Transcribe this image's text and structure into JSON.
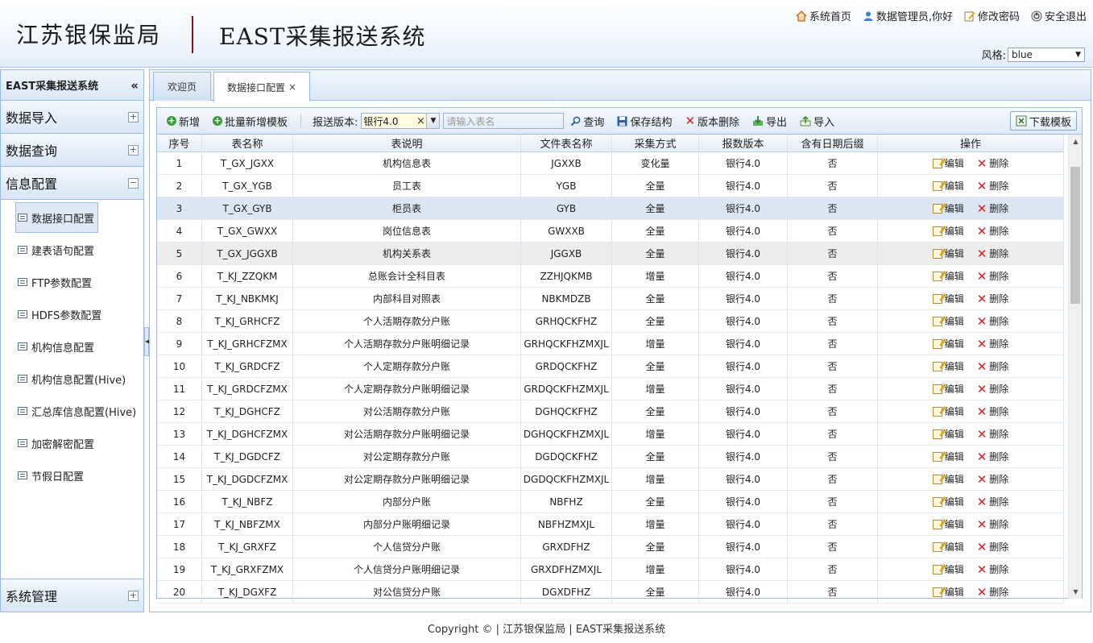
{
  "header": {
    "org_name": "江苏银保监局",
    "system_name": "EAST采集报送系统",
    "links": {
      "home": "系统首页",
      "user": "数据管理员,你好",
      "change_password": "修改密码",
      "logout": "安全退出"
    },
    "style_label": "风格:",
    "style_value": "blue"
  },
  "sidebar": {
    "title": "EAST采集报送系统",
    "collapse_glyph": "«",
    "groups": [
      {
        "label": "数据导入",
        "toggle": "+"
      },
      {
        "label": "数据查询",
        "toggle": "+"
      },
      {
        "label": "信息配置",
        "toggle": "−"
      }
    ],
    "items": [
      {
        "label": "数据接口配置"
      },
      {
        "label": "建表语句配置"
      },
      {
        "label": "FTP参数配置"
      },
      {
        "label": "HDFS参数配置"
      },
      {
        "label": "机构信息配置"
      },
      {
        "label": "机构信息配置(Hive)"
      },
      {
        "label": "汇总库信息配置(Hive)"
      },
      {
        "label": "加密解密配置"
      },
      {
        "label": "节假日配置"
      }
    ],
    "bottom_group": {
      "label": "系统管理",
      "toggle": "+"
    }
  },
  "tabs": [
    {
      "label": "欢迎页"
    },
    {
      "label": "数据接口配置",
      "close": "×"
    }
  ],
  "toolbar": {
    "add": "新增",
    "batch_add": "批量新增模板",
    "version_label": "报送版本:",
    "version_value": "银行4.0",
    "version_clear": "×",
    "table_placeholder": "请输入表名",
    "query": "查询",
    "save_structure": "保存结构",
    "delete_version": "版本删除",
    "export": "导出",
    "import": "导入",
    "download_template": "下载模板"
  },
  "table": {
    "columns": [
      "序号",
      "表名称",
      "表说明",
      "文件表名称",
      "采集方式",
      "报数版本",
      "含有日期后缀",
      "操作"
    ],
    "edit_label": "编辑",
    "delete_label": "删除",
    "rows": [
      [
        "1",
        "T_GX_JGXX",
        "机构信息表",
        "JGXXB",
        "变化量",
        "银行4.0",
        "否"
      ],
      [
        "2",
        "T_GX_YGB",
        "员工表",
        "YGB",
        "全量",
        "银行4.0",
        "否"
      ],
      [
        "3",
        "T_GX_GYB",
        "柜员表",
        "GYB",
        "全量",
        "银行4.0",
        "否"
      ],
      [
        "4",
        "T_GX_GWXX",
        "岗位信息表",
        "GWXXB",
        "全量",
        "银行4.0",
        "否"
      ],
      [
        "5",
        "T_GX_JGGXB",
        "机构关系表",
        "JGGXB",
        "全量",
        "银行4.0",
        "否"
      ],
      [
        "6",
        "T_KJ_ZZQKM",
        "总账会计全科目表",
        "ZZHJQKMB",
        "增量",
        "银行4.0",
        "否"
      ],
      [
        "7",
        "T_KJ_NBKMKJ",
        "内部科目对照表",
        "NBKMDZB",
        "全量",
        "银行4.0",
        "否"
      ],
      [
        "8",
        "T_KJ_GRHCFZ",
        "个人活期存款分户账",
        "GRHQCKFHZ",
        "全量",
        "银行4.0",
        "否"
      ],
      [
        "9",
        "T_KJ_GRHCFZMX",
        "个人活期存款分户账明细记录",
        "GRHQCKFHZMXJL",
        "增量",
        "银行4.0",
        "否"
      ],
      [
        "10",
        "T_KJ_GRDCFZ",
        "个人定期存款分户账",
        "GRDQCKFHZ",
        "全量",
        "银行4.0",
        "否"
      ],
      [
        "11",
        "T_KJ_GRDCFZMX",
        "个人定期存款分户账明细记录",
        "GRDQCKFHZMXJL",
        "增量",
        "银行4.0",
        "否"
      ],
      [
        "12",
        "T_KJ_DGHCFZ",
        "对公活期存款分户账",
        "DGHQCKFHZ",
        "全量",
        "银行4.0",
        "否"
      ],
      [
        "13",
        "T_KJ_DGHCFZMX",
        "对公活期存款分户账明细记录",
        "DGHQCKFHZMXJL",
        "增量",
        "银行4.0",
        "否"
      ],
      [
        "14",
        "T_KJ_DGDCFZ",
        "对公定期存款分户账",
        "DGDQCKFHZ",
        "全量",
        "银行4.0",
        "否"
      ],
      [
        "15",
        "T_KJ_DGDCFZMX",
        "对公定期存款分户账明细记录",
        "DGDQCKFHZMXJL",
        "增量",
        "银行4.0",
        "否"
      ],
      [
        "16",
        "T_KJ_NBFZ",
        "内部分户账",
        "NBFHZ",
        "全量",
        "银行4.0",
        "否"
      ],
      [
        "17",
        "T_KJ_NBFZMX",
        "内部分户账明细记录",
        "NBFHZMXJL",
        "增量",
        "银行4.0",
        "否"
      ],
      [
        "18",
        "T_KJ_GRXFZ",
        "个人信贷分户账",
        "GRXDFHZ",
        "全量",
        "银行4.0",
        "否"
      ],
      [
        "19",
        "T_KJ_GRXFZMX",
        "个人信贷分户账明细记录",
        "GRXDFHZMXJL",
        "增量",
        "银行4.0",
        "否"
      ],
      [
        "20",
        "T_KJ_DGXFZ",
        "对公信贷分户账",
        "DGXDFHZ",
        "全量",
        "银行4.0",
        "否"
      ]
    ]
  },
  "footer": "Copyright © | 江苏银保监局 | EAST采集报送系统"
}
